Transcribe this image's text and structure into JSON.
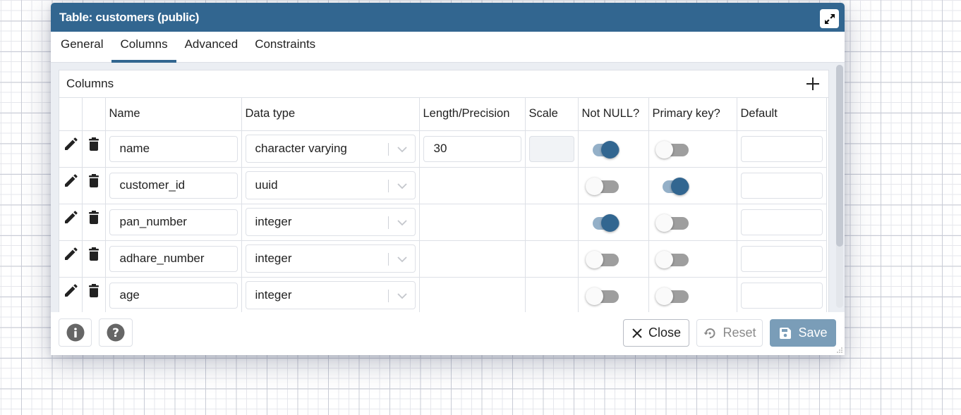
{
  "dialog": {
    "title": "Table: customers (public)",
    "expand_icon": "expand-arrows-icon"
  },
  "tabs": [
    {
      "label": "General",
      "active": false
    },
    {
      "label": "Columns",
      "active": true
    },
    {
      "label": "Advanced",
      "active": false
    },
    {
      "label": "Constraints",
      "active": false
    }
  ],
  "columns_panel": {
    "title": "Columns",
    "add_icon": "plus-icon",
    "headers": [
      "",
      "",
      "Name",
      "Data type",
      "Length/Precision",
      "Scale",
      "Not NULL?",
      "Primary key?",
      "Default"
    ],
    "rows": [
      {
        "name": "name",
        "data_type": "character varying",
        "length": "30",
        "scale": "",
        "scale_disabled": true,
        "not_null": true,
        "primary_key": false,
        "default": ""
      },
      {
        "name": "customer_id",
        "data_type": "uuid",
        "length": "",
        "scale": "",
        "not_null": false,
        "primary_key": true,
        "default": ""
      },
      {
        "name": "pan_number",
        "data_type": "integer",
        "length": "",
        "scale": "",
        "not_null": true,
        "primary_key": false,
        "default": ""
      },
      {
        "name": "adhare_number",
        "data_type": "integer",
        "length": "",
        "scale": "",
        "not_null": false,
        "primary_key": false,
        "default": ""
      },
      {
        "name": "age",
        "data_type": "integer",
        "length": "",
        "scale": "",
        "not_null": false,
        "primary_key": false,
        "default": ""
      }
    ]
  },
  "footer": {
    "info_icon": "info-icon",
    "help_icon": "help-icon",
    "close_label": "Close",
    "reset_label": "Reset",
    "save_label": "Save"
  },
  "colors": {
    "accent": "#326690",
    "save_button": "#7a9db8",
    "toggle_on_track": "#94b0c8",
    "toggle_off_track": "#9e9e9e"
  }
}
